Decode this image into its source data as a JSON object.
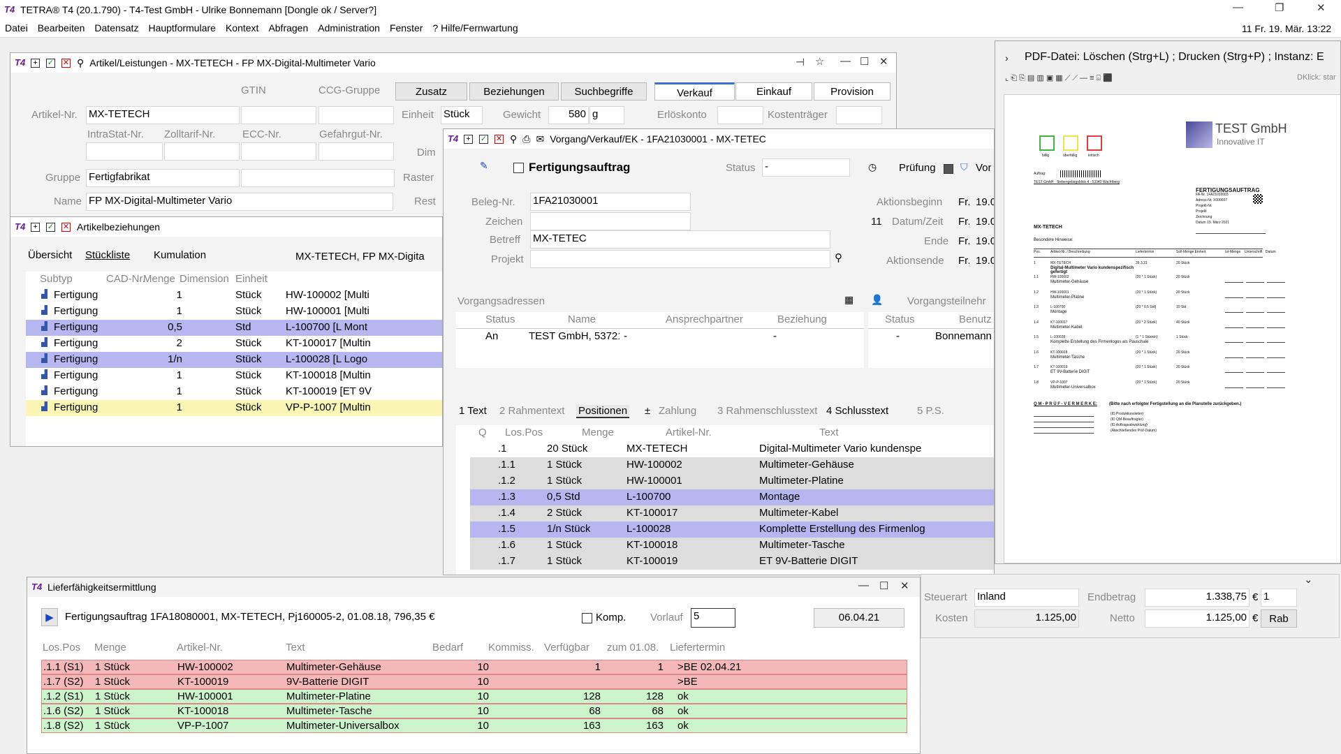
{
  "app": {
    "title": "TETRA® T4 (20.1.790) - T4-Test GmbH - Ulrike Bonnemann  [Dongle ok / Server?]",
    "datetime": "11  Fr. 19. Mär.  13:22"
  },
  "menu": [
    "Datei",
    "Bearbeiten",
    "Datensatz",
    "Hauptformulare",
    "Kontext",
    "Abfragen",
    "Administration",
    "Fenster",
    "? Hilfe/Fernwartung"
  ],
  "artikel": {
    "title": "Artikel/Leistungen - MX-TETECH - FP MX-Digital-Multimeter Vario",
    "gtin": "GTIN",
    "ccg": "CCG-Gruppe",
    "btn_zusatz": "Zusatz",
    "btn_bez": "Beziehungen",
    "btn_such": "Suchbegriffe",
    "tab_verkauf": "Verkauf",
    "tab_einkauf": "Einkauf",
    "tab_provision": "Provision",
    "artnr_lbl": "Artikel-Nr.",
    "artnr": "MX-TETECH",
    "einheit_lbl": "Einheit",
    "einheit": "Stück",
    "gewicht_lbl": "Gewicht",
    "gewicht": "580",
    "gewicht_unit": "g",
    "erloes": "Erlöskonto",
    "kostentr": "Kostenträger",
    "intrastat": "IntraStat-Nr.",
    "zolltarif": "Zolltarif-Nr.",
    "ecc": "ECC-Nr.",
    "gefahrgut": "Gefahrgut-Nr.",
    "dim": "Dim",
    "gruppe_lbl": "Gruppe",
    "gruppe": "Fertigfabrikat",
    "raster": "Raster",
    "name_lbl": "Name",
    "name": "FP MX-Digital-Multimeter Vario",
    "rest": "Rest"
  },
  "artbez": {
    "title": "Artikelbeziehungen",
    "tabs": [
      "Übersicht",
      "Stückliste",
      "Kumulation"
    ],
    "header_text": "MX-TETECH, FP MX-Digita",
    "cols": [
      "Subtyp",
      "CAD-Nr.",
      "Menge",
      "Dimension",
      "Einheit"
    ],
    "rows": [
      [
        "Fertigung",
        "",
        "1",
        "",
        "Stück",
        "HW-100002  [Multi"
      ],
      [
        "Fertigung",
        "",
        "1",
        "",
        "Stück",
        "HW-100001  [Multi"
      ],
      [
        "Fertigung",
        "",
        "0,5",
        "",
        "Std",
        "L-100700  [L Mont"
      ],
      [
        "Fertigung",
        "",
        "2",
        "",
        "Stück",
        "KT-100017  [Multin"
      ],
      [
        "Fertigung",
        "",
        "1/n",
        "",
        "Stück",
        "L-100028  [L Logo"
      ],
      [
        "Fertigung",
        "",
        "1",
        "",
        "Stück",
        "KT-100018  [Multin"
      ],
      [
        "Fertigung",
        "",
        "1",
        "",
        "Stück",
        "KT-100019  [ET 9V"
      ],
      [
        "Fertigung",
        "",
        "1",
        "",
        "Stück",
        "VP-P-1007  [Multin"
      ]
    ]
  },
  "vorgang": {
    "title": "Vorgang/Verkauf/EK - 1FA21030001 - MX-TETEC",
    "fertigung": "Fertigungsauftrag",
    "status_lbl": "Status",
    "status": "-",
    "pruefung": "Prüfung",
    "vor": "Vor",
    "beleg_lbl": "Beleg-Nr.",
    "beleg": "1FA21030001",
    "zeichen_lbl": "Zeichen",
    "betreff_lbl": "Betreff",
    "betreff": "MX-TETEC",
    "projekt_lbl": "Projekt",
    "aktbeg_lbl": "Aktionsbeginn",
    "fr": "Fr.",
    "fr_val": "19.0",
    "datum_lbl": "Datum/Zeit",
    "datum_pre": "11",
    "ende_lbl": "Ende",
    "aktende_lbl": "Aktionsende",
    "adr_title": "Vorgangsadressen",
    "adr_cols": [
      "Status",
      "Name",
      "Ansprechpartner",
      "Beziehung"
    ],
    "adr_row": [
      "An",
      "TEST GmbH, 53721 \\",
      "-",
      "-"
    ],
    "teiln_title": "Vorgangsteilnehr",
    "teiln_cols": [
      "Status",
      "Benutz"
    ],
    "teiln_row": [
      "-",
      "Bonnemann"
    ],
    "tabs": [
      "1 Text",
      "2 Rahmentext",
      "Positionen",
      "±",
      "Zahlung",
      "3 Rahmenschlusstext",
      "4 Schlusstext",
      "5 P.S."
    ],
    "pos_cols": [
      "Q",
      "Los.Pos",
      "Menge",
      "Artikel-Nr.",
      "Text"
    ],
    "pos": [
      [
        ".1",
        "20 Stück",
        "MX-TETECH",
        "Digital-Multimeter Vario kundenspe"
      ],
      [
        ".1.1",
        "1 Stück",
        "HW-100002",
        "Multimeter-Gehäuse"
      ],
      [
        ".1.2",
        "1 Stück",
        "HW-100001",
        "Multimeter-Platine"
      ],
      [
        ".1.3",
        "0,5 Std",
        "L-100700",
        "Montage"
      ],
      [
        ".1.4",
        "2 Stück",
        "KT-100017",
        "Multimeter-Kabel"
      ],
      [
        ".1.5",
        "1/n Stück",
        "L-100028",
        "Komplette Erstellung des Firmenlog"
      ],
      [
        ".1.6",
        "1 Stück",
        "KT-100018",
        "Multimeter-Tasche"
      ],
      [
        ".1.7",
        "1 Stück",
        "KT-100019",
        "ET 9V-Batterie DIGIT"
      ]
    ]
  },
  "pdf": {
    "title": "PDF-Datei: Löschen (Strg+L) ; Drucken (Strg+P) ; Instanz: E",
    "dklick": "DKlick: star",
    "logo1": "TEST GmbH",
    "logo2": "Innovative IT",
    "swatch_labels": [
      "billig",
      "überfällig",
      "kritisch"
    ],
    "doc_title": "FERTIGUNGSAUFTRAG",
    "customer": "MX-TETECH",
    "hinweise": "Besondere Hinweise:",
    "sender": "TEST GmbH · Siebengebirgsblick 4 · 53343 Wachtberg",
    "auftrag_lbl": "Auftrag:",
    "meta": [
      "FA-Nr.   1FA21030003",
      "Adress-Nr.   X000007",
      "Projekt-Nr.",
      "Projekt",
      "Zeichnung",
      "Datum   19. März 2021"
    ],
    "cols": [
      "Pos.",
      "Artikel-Nr. / Beschreibung",
      "Liefertermin",
      "Soll-Menge Einheit",
      "Ist-Menge",
      "Unterschrift",
      "Datum"
    ],
    "lines": [
      [
        "1",
        "MX-TETECH",
        "Digital-Multimeter Vario kundenspezifisch gefertigt",
        "26.3.21",
        "20 Stück"
      ],
      [
        "1.1",
        "HW-100002",
        "Multimeter-Gehäuse",
        "(20 * 1 Stück)",
        "20 Stück"
      ],
      [
        "1.2",
        "HW-100001",
        "Multimeter-Platine",
        "(20 * 1 Stück)",
        "20 Stück"
      ],
      [
        "1.3",
        "L-100700",
        "Montage",
        "(20 * 0,5 Std)",
        "10 Std"
      ],
      [
        "1.4",
        "KT-100017",
        "Multimeter-Kabel",
        "(20 * 2 Stück)",
        "40 Stück"
      ],
      [
        "1.5",
        "L-100028",
        "Komplette Erstellung des Firmenlogos als Pauschale",
        "(1 * 1 Stück/n)",
        "1 Stück"
      ],
      [
        "1.6",
        "KT-100018",
        "Multimeter-Tasche",
        "(20 * 1 Stück)",
        "20 Stück"
      ],
      [
        "1.7",
        "KT-100019",
        "ET 9V-Batterie DIGIT",
        "(20 * 1 Stück)",
        "20 Stück"
      ],
      [
        "1.8",
        "VP-P-1007",
        "Multimeter-Universalbox",
        "(20 * 1 Stück)",
        "20 Stück"
      ]
    ],
    "qm": "Q M - P R Ü F - V E R M E R K E:",
    "qm_note": "(Bitte nach erfolgter Fertigstellung an die Planstelle zurückgeben.)",
    "qm_lines": [
      "(ID Produktionsleiter)",
      "(ID QM-Beauftragter)",
      "(ID Auftragsabwicklung)",
      "(Abschließendes Prüf-Datum)"
    ]
  },
  "totals": {
    "steuerart_lbl": "Steuerart",
    "steuerart": "Inland",
    "endbetrag_lbl": "Endbetrag",
    "endbetrag": "1.338,75",
    "cur": "€",
    "qty": "1",
    "kosten_lbl": "Kosten",
    "kosten": "1.125,00",
    "netto_lbl": "Netto",
    "netto": "1.125,00",
    "rab": "Rab"
  },
  "liefer": {
    "title": "Lieferfähigkeitsermittlung",
    "info": "Fertigungsauftrag 1FA18080001,  MX-TETECH,  Pj160005-2,  01.08.18,   796,35 €",
    "komp": "Komp.",
    "vorlauf_lbl": "Vorlauf",
    "vorlauf": "5",
    "date": "06.04.21",
    "cols": [
      "Los.Pos",
      "Menge",
      "Artikel-Nr.",
      "Text",
      "Bedarf",
      "Kommiss.",
      "Verfügbar",
      "zum 01.08.",
      "Liefertermin"
    ],
    "rows": [
      [
        ".1.1 (S1)",
        "1 Stück",
        "HW-100002",
        "Multimeter-Gehäuse",
        "10",
        "",
        "1",
        "1",
        ">BE 02.04.21"
      ],
      [
        ".1.7 (S2)",
        "1 Stück",
        "KT-100019",
        "9V-Batterie DIGIT",
        "10",
        "",
        "",
        "",
        ">BE"
      ],
      [
        ".1.2 (S1)",
        "1 Stück",
        "HW-100001",
        "Multimeter-Platine",
        "10",
        "",
        "128",
        "128",
        "ok"
      ],
      [
        ".1.6 (S2)",
        "1 Stück",
        "KT-100018",
        "Multimeter-Tasche",
        "10",
        "",
        "68",
        "68",
        "ok"
      ],
      [
        ".1.8 (S2)",
        "1 Stück",
        "VP-P-1007",
        "Multimeter-Universalbox",
        "10",
        "",
        "163",
        "163",
        "ok"
      ]
    ]
  }
}
